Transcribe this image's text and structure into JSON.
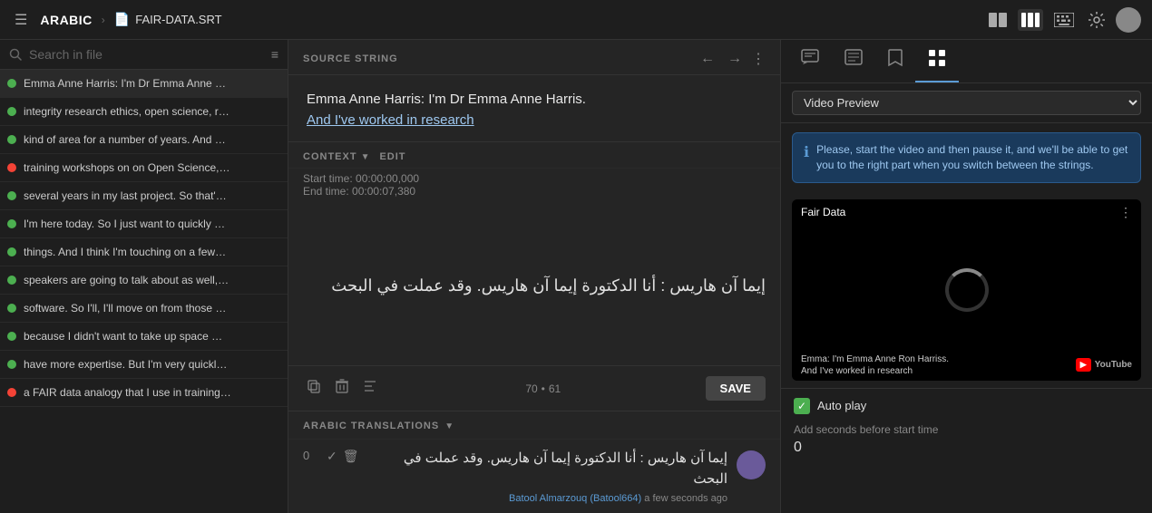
{
  "topbar": {
    "menu_icon": "☰",
    "brand": "ARABIC",
    "arrow": "›",
    "file_icon": "📄",
    "file_name": "FAIR-DATA.SRT",
    "icons": {
      "layout1": "⊟",
      "layout2": "⊞",
      "keyboard": "⌨",
      "settings": "⚙"
    }
  },
  "left_panel": {
    "search_placeholder": "Search in file",
    "filter_icon": "≡",
    "items": [
      {
        "id": 1,
        "status": "green",
        "text": "Emma Anne Harris: I'm Dr Emma Anne …"
      },
      {
        "id": 2,
        "status": "green",
        "text": "integrity research ethics, open science, r…"
      },
      {
        "id": 3,
        "status": "green",
        "text": "kind of area for a number of years. And …"
      },
      {
        "id": 4,
        "status": "red",
        "text": "training workshops on on Open Science,…"
      },
      {
        "id": 5,
        "status": "green",
        "text": "several years in my last project. So that'…"
      },
      {
        "id": 6,
        "status": "green",
        "text": "I'm here today. So I just want to quickly …"
      },
      {
        "id": 7,
        "status": "green",
        "text": "things. And I think I'm touching on a few…"
      },
      {
        "id": 8,
        "status": "green",
        "text": "speakers are going to talk about as well,…"
      },
      {
        "id": 9,
        "status": "green",
        "text": "software. So I'll, I'll move on from those …"
      },
      {
        "id": 10,
        "status": "green",
        "text": "because I didn't want to take up space …"
      },
      {
        "id": 11,
        "status": "green",
        "text": "have more expertise. But I'm very quickl…"
      },
      {
        "id": 12,
        "status": "red",
        "text": "a FAIR data analogy that I use in training…"
      }
    ]
  },
  "center_panel": {
    "source_label": "SOURCE STRING",
    "source_text_part1": "Emma Anne Harris: I'm Dr Emma Anne Harris.",
    "source_text_part2": "And I've worked in research",
    "context_label": "CONTEXT",
    "edit_label": "EDIT",
    "start_time": "Start time: 00:00:00,000",
    "end_time": "End time: 00:00:07,380",
    "translation_rtl": "إيما آن هاريس : أنا الدكتورة إيما آن هاريس. وقد عملت في البحث",
    "char_count_src": "70",
    "char_count_tgt": "61",
    "char_dot": "•",
    "save_label": "SAVE",
    "arabic_trans_label": "ARABIC TRANSLATIONS",
    "translation_item": {
      "num": "0",
      "text": "إيما آن هاريس : أنا الدكتورة إيما آن هاريس. وقد عملت في البحث",
      "contributor": "Batool Almarzouq (Batool664)",
      "time_ago": "a few seconds ago"
    }
  },
  "right_panel": {
    "tabs": [
      {
        "id": "chat",
        "icon": "💬",
        "active": false
      },
      {
        "id": "list",
        "icon": "☰",
        "active": false
      },
      {
        "id": "bookmark",
        "icon": "🔖",
        "active": false
      },
      {
        "id": "grid",
        "icon": "⊞",
        "active": true
      }
    ],
    "video_preview_label": "Video Preview",
    "info_banner": "Please, start the video and then pause it, and we'll be able to get you to the right part when you switch between the strings.",
    "video_title": "Fair Data",
    "video_caption_line1": "Emma: I'm Emma Anne Ron Harriss.",
    "video_caption_line2": "And I've worked in research",
    "autoplay_label": "Auto play",
    "seconds_label": "Add seconds before start time",
    "seconds_value": "0"
  }
}
